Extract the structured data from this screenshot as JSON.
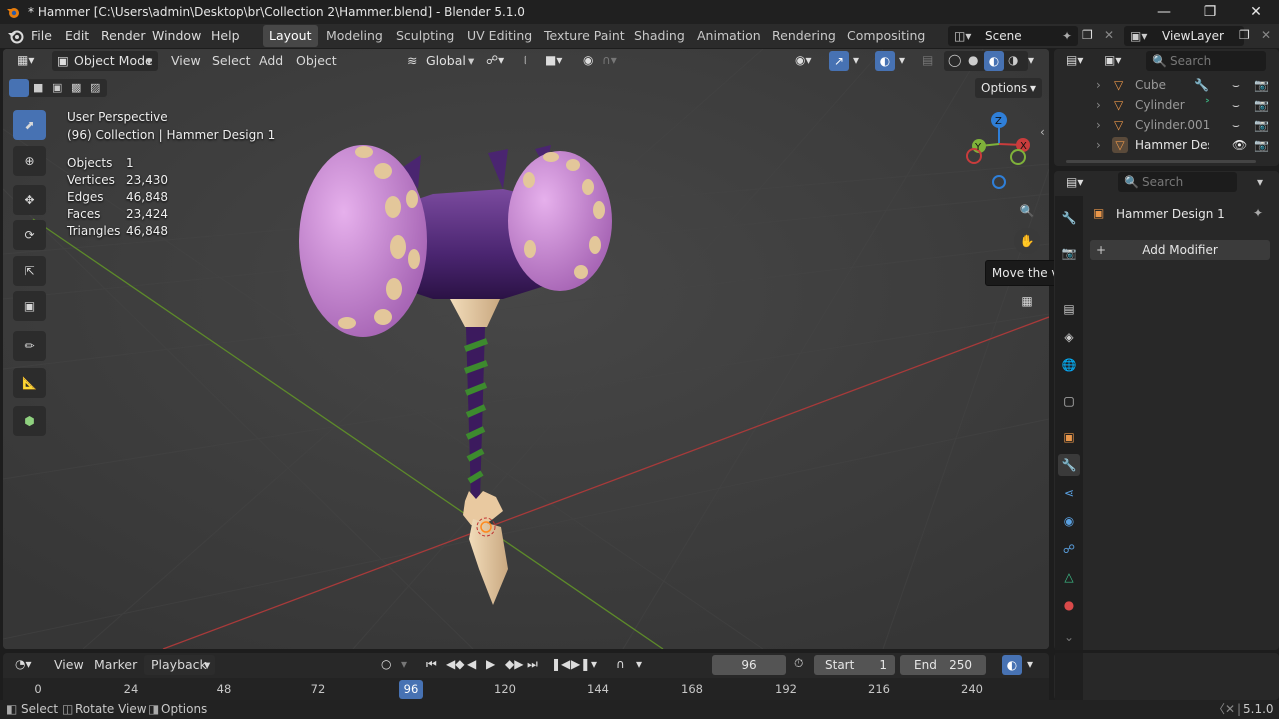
{
  "window": {
    "title": "* Hammer [C:\\Users\\admin\\Desktop\\br\\Collection 2\\Hammer.blend] - Blender 5.1.0"
  },
  "menus": [
    "File",
    "Edit",
    "Render",
    "Window",
    "Help"
  ],
  "workspaces": [
    "Layout",
    "Modeling",
    "Sculpting",
    "UV Editing",
    "Texture Paint",
    "Shading",
    "Animation",
    "Rendering",
    "Compositing"
  ],
  "active_workspace": "Layout",
  "scene": {
    "name": "Scene",
    "view_layer": "ViewLayer"
  },
  "viewport_header": {
    "mode": "Object Mode",
    "menus": [
      "View",
      "Select",
      "Add",
      "Object"
    ],
    "orientation": "Global",
    "options_label": "Options"
  },
  "overlay": {
    "perspective": "User Perspective",
    "collection": "(96) Collection | Hammer Design 1",
    "stats": [
      {
        "label": "Objects",
        "value": "1"
      },
      {
        "label": "Vertices",
        "value": "23,430"
      },
      {
        "label": "Edges",
        "value": "46,848"
      },
      {
        "label": "Faces",
        "value": "23,424"
      },
      {
        "label": "Triangles",
        "value": "46,848"
      }
    ]
  },
  "gizmo": {
    "x": "X",
    "y": "Y",
    "z": "Z"
  },
  "tooltip": "Move the view",
  "outliner": {
    "search_placeholder": "Search",
    "items": [
      "Cube",
      "Cylinder",
      "Cylinder.001",
      "Hammer Desig"
    ]
  },
  "properties": {
    "search_placeholder": "Search",
    "object_name": "Hammer Design 1",
    "add_modifier": "Add Modifier"
  },
  "timeline": {
    "menus": [
      "View",
      "Marker",
      "Playback"
    ],
    "current_frame": "96",
    "start_label": "Start",
    "start": "1",
    "end_label": "End",
    "end": "250",
    "ruler": [
      "0",
      "24",
      "48",
      "72",
      "96",
      "120",
      "144",
      "168",
      "192",
      "216",
      "240"
    ]
  },
  "status": {
    "items": [
      "Select",
      "Rotate View",
      "Options"
    ],
    "version": "5.1.0"
  },
  "colors": {
    "accent": "#4772b3",
    "x_axis": "#c93c3c",
    "y_axis": "#7fb23a",
    "z_axis": "#2f7fd8"
  }
}
